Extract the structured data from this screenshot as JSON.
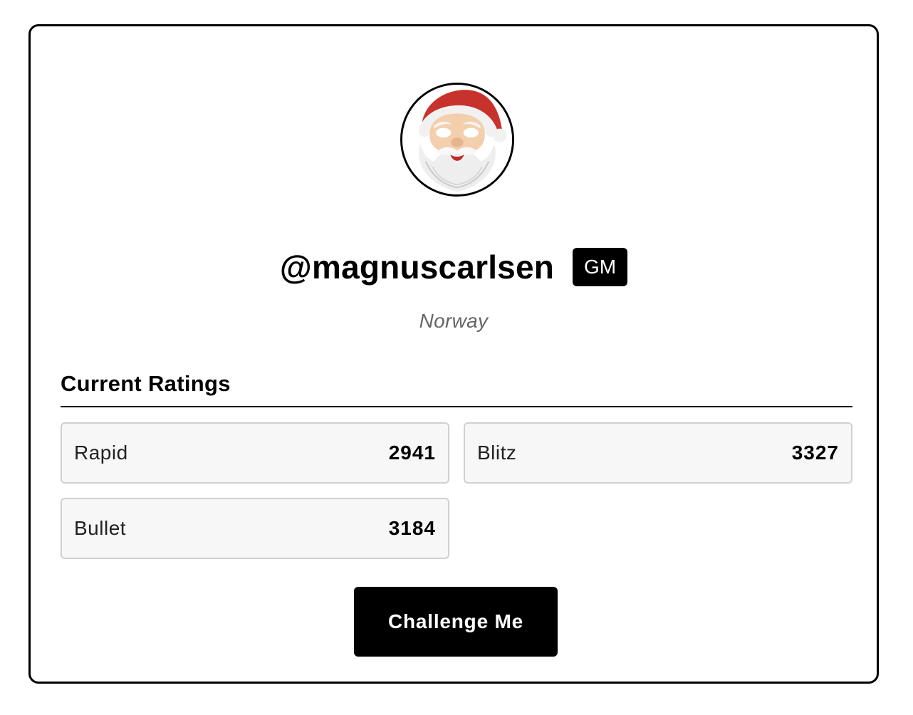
{
  "profile": {
    "username": "@magnuscarlsen",
    "title_badge": "GM",
    "country": "Norway",
    "avatar_icon": "santa-mask-avatar"
  },
  "ratings": {
    "heading": "Current Ratings",
    "items": [
      {
        "label": "Rapid",
        "value": "2941"
      },
      {
        "label": "Blitz",
        "value": "3327"
      },
      {
        "label": "Bullet",
        "value": "3184"
      }
    ]
  },
  "actions": {
    "challenge_label": "Challenge Me"
  },
  "colors": {
    "primary": "#000000",
    "card_bg": "#f7f7f7",
    "card_border": "#d0d0d0",
    "muted_text": "#666666"
  }
}
